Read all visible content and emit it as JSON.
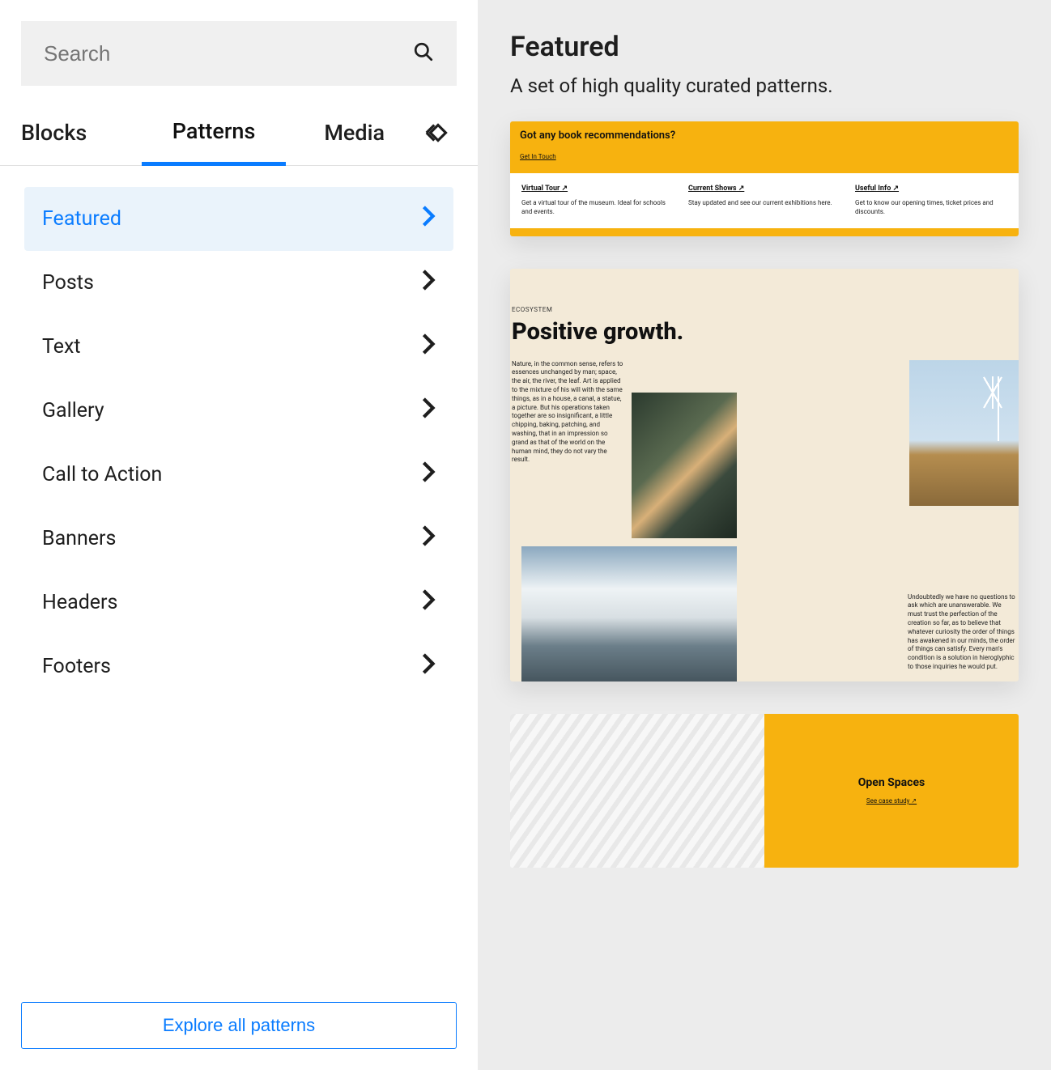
{
  "search": {
    "placeholder": "Search"
  },
  "tabs": {
    "blocks": "Blocks",
    "patterns": "Patterns",
    "media": "Media"
  },
  "categories": [
    {
      "label": "Featured",
      "active": true
    },
    {
      "label": "Posts"
    },
    {
      "label": "Text"
    },
    {
      "label": "Gallery"
    },
    {
      "label": "Call to Action"
    },
    {
      "label": "Banners"
    },
    {
      "label": "Headers"
    },
    {
      "label": "Footers"
    }
  ],
  "explore_label": "Explore all patterns",
  "preview": {
    "title": "Featured",
    "subtitle": "A set of high quality curated patterns."
  },
  "card1": {
    "question": "Got any book recommendations?",
    "cta": "Get In Touch",
    "cols": [
      {
        "heading": "Virtual Tour ↗",
        "text": "Get a virtual tour of the museum. Ideal for schools and events."
      },
      {
        "heading": "Current Shows ↗",
        "text": "Stay updated and see our current exhibitions here."
      },
      {
        "heading": "Useful Info ↗",
        "text": "Get to know our opening times, ticket prices and discounts."
      }
    ]
  },
  "card2": {
    "label": "ECOSYSTEM",
    "heading": "Positive growth.",
    "p1": "Nature, in the common sense, refers to essences unchanged by man; space, the air, the river, the leaf. Art is applied to the mixture of his will with the same things, as in a house, a canal, a statue, a picture. But his operations taken together are so insignificant, a little chipping, baking, patching, and washing, that in an impression so grand as that of the world on the human mind, they do not vary the result.",
    "p2": "Undoubtedly we have no questions to ask which are unanswerable. We must trust the perfection of the creation so far, as to believe that whatever curiosity the order of things has awakened in our minds, the order of things can satisfy. Every man's condition is a solution in hieroglyphic to those inquiries he would put."
  },
  "card3": {
    "heading": "Open Spaces",
    "link": "See case study ↗"
  }
}
